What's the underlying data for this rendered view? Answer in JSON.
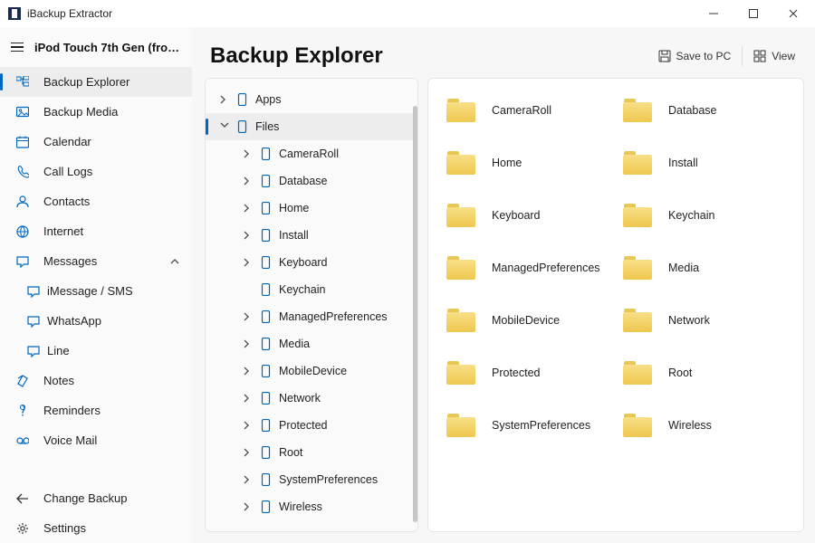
{
  "app": {
    "title": "iBackup Extractor"
  },
  "window_controls": {
    "minimize": "−",
    "maximize": "□",
    "close": "✕"
  },
  "device": {
    "label": "iPod Touch 7th Gen (from To…"
  },
  "sidebar": {
    "items": [
      {
        "label": "Backup Explorer",
        "icon": "folder-tree",
        "selected": true
      },
      {
        "label": "Backup Media",
        "icon": "image"
      },
      {
        "label": "Calendar",
        "icon": "calendar"
      },
      {
        "label": "Call Logs",
        "icon": "phone"
      },
      {
        "label": "Contacts",
        "icon": "user"
      },
      {
        "label": "Internet",
        "icon": "globe"
      },
      {
        "label": "Messages",
        "icon": "message",
        "expanded": true,
        "children": [
          {
            "label": "iMessage / SMS"
          },
          {
            "label": "WhatsApp"
          },
          {
            "label": "Line"
          }
        ]
      },
      {
        "label": "Notes",
        "icon": "note"
      },
      {
        "label": "Reminders",
        "icon": "reminder"
      },
      {
        "label": "Voice Mail",
        "icon": "voicemail"
      }
    ],
    "footer": [
      {
        "label": "Change Backup",
        "icon": "back"
      },
      {
        "label": "Settings",
        "icon": "gear"
      }
    ]
  },
  "page": {
    "title": "Backup Explorer",
    "actions": {
      "save": "Save to PC",
      "view": "View"
    }
  },
  "tree": {
    "root": [
      {
        "label": "Apps",
        "expandable": true
      },
      {
        "label": "Files",
        "expandable": true,
        "expanded": true,
        "selected": true,
        "children": [
          {
            "label": "CameraRoll",
            "expandable": true
          },
          {
            "label": "Database",
            "expandable": true
          },
          {
            "label": "Home",
            "expandable": true
          },
          {
            "label": "Install",
            "expandable": true
          },
          {
            "label": "Keyboard",
            "expandable": true
          },
          {
            "label": "Keychain",
            "expandable": false
          },
          {
            "label": "ManagedPreferences",
            "expandable": true
          },
          {
            "label": "Media",
            "expandable": true
          },
          {
            "label": "MobileDevice",
            "expandable": true
          },
          {
            "label": "Network",
            "expandable": true
          },
          {
            "label": "Protected",
            "expandable": true
          },
          {
            "label": "Root",
            "expandable": true
          },
          {
            "label": "SystemPreferences",
            "expandable": true
          },
          {
            "label": "Wireless",
            "expandable": true
          }
        ]
      }
    ]
  },
  "grid": {
    "folders": [
      "CameraRoll",
      "Database",
      "Home",
      "Install",
      "Keyboard",
      "Keychain",
      "ManagedPreferences",
      "Media",
      "MobileDevice",
      "Network",
      "Protected",
      "Root",
      "SystemPreferences",
      "Wireless"
    ]
  }
}
